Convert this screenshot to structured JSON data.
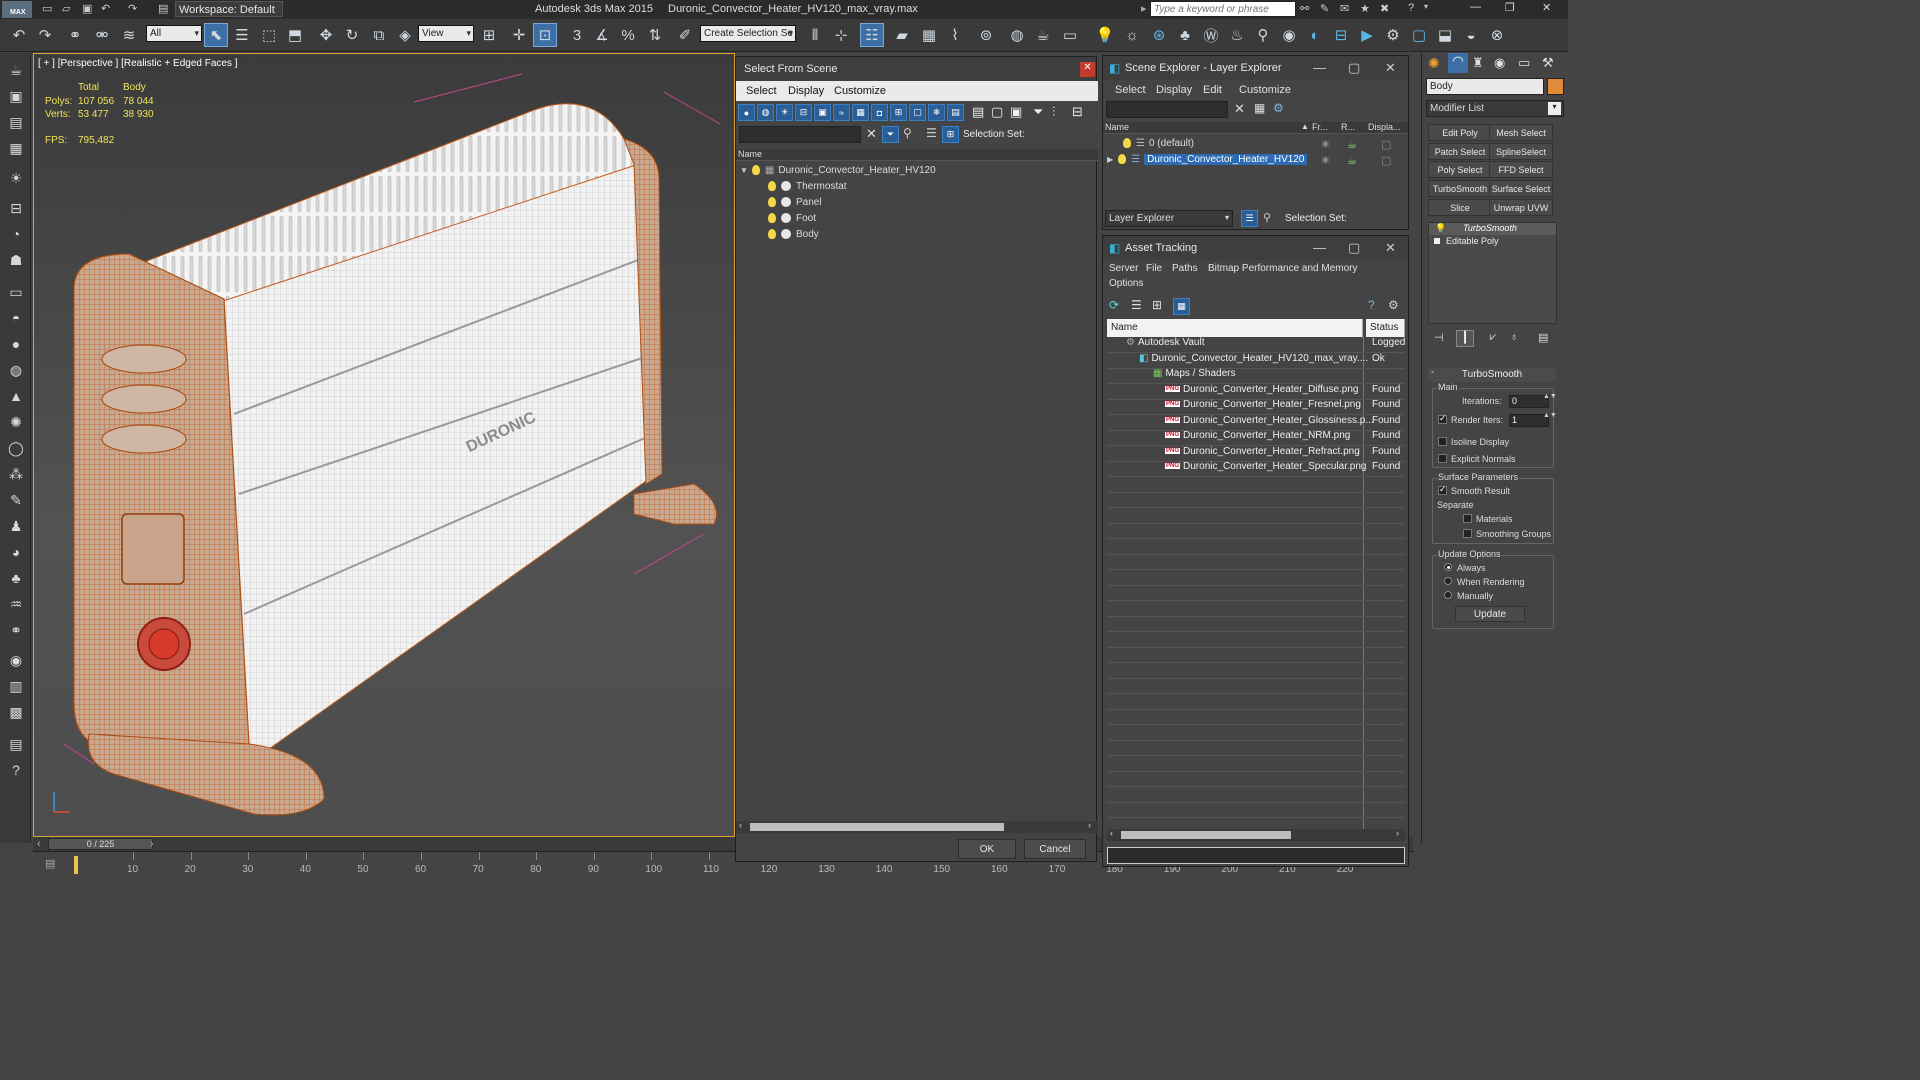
{
  "app": {
    "title": "Autodesk 3ds Max  2015",
    "file": "Duronic_Convector_Heater_HV120_max_vray.max",
    "logo": "MAX",
    "workspace": "Workspace: Default",
    "search_placeholder": "Type a keyword or phrase"
  },
  "toolbar": {
    "filter": "All",
    "ref_coord": "View",
    "selection_set_placeholder": "Create Selection Se"
  },
  "viewport": {
    "label": "[ + ] [Perspective ] [Realistic + Edged Faces ]",
    "stats_header_total": "Total",
    "stats_header_obj": "Body",
    "polys_label": "Polys:",
    "polys_total": "107 056",
    "polys_obj": "78 044",
    "verts_label": "Verts:",
    "verts_total": "53 477",
    "verts_obj": "38 930",
    "fps_label": "FPS:",
    "fps_value": "795,482",
    "brand_text": "DURONIC"
  },
  "timeline": {
    "frame": "0 / 225",
    "ticks": [
      "10",
      "20",
      "30",
      "40",
      "50",
      "60",
      "70",
      "80",
      "90",
      "100",
      "110",
      "120",
      "130",
      "140",
      "150",
      "160",
      "170",
      "180",
      "190",
      "200",
      "210",
      "220"
    ]
  },
  "select_from_scene": {
    "title": "Select From Scene",
    "menus": [
      "Select",
      "Display",
      "Customize"
    ],
    "selection_set_label": "Selection Set:",
    "column_name": "Name",
    "root": "Duronic_Convector_Heater_HV120",
    "children": [
      "Thermostat",
      "Panel",
      "Foot",
      "Body"
    ],
    "ok": "OK",
    "cancel": "Cancel"
  },
  "scene_explorer": {
    "title": "Scene Explorer - Layer Explorer",
    "menus": [
      "Select",
      "Display",
      "Edit",
      "Customize"
    ],
    "columns": [
      "Name",
      "Fr...",
      "R...",
      "Displa..."
    ],
    "rows": [
      "0 (default)",
      "Duronic_Convector_Heater_HV120"
    ],
    "footer_combo": "Layer Explorer",
    "footer_label": "Selection Set:"
  },
  "asset_tracking": {
    "title": "Asset Tracking",
    "menus": [
      "Server",
      "File",
      "Paths",
      "Bitmap Performance and Memory",
      "Options"
    ],
    "columns": [
      "Name",
      "Status"
    ],
    "rows": [
      {
        "name": "Autodesk Vault",
        "status": "Logged"
      },
      {
        "name": "Duronic_Convector_Heater_HV120_max_vray....",
        "status": "Ok"
      },
      {
        "name": "Maps / Shaders",
        "status": ""
      },
      {
        "name": "Duronic_Converter_Heater_Diffuse.png",
        "status": "Found"
      },
      {
        "name": "Duronic_Converter_Heater_Fresnel.png",
        "status": "Found"
      },
      {
        "name": "Duronic_Converter_Heater_Glossiness.p...",
        "status": "Found"
      },
      {
        "name": "Duronic_Converter_Heater_NRM.png",
        "status": "Found"
      },
      {
        "name": "Duronic_Converter_Heater_Refract.png",
        "status": "Found"
      },
      {
        "name": "Duronic_Converter_Heater_Specular.png",
        "status": "Found"
      }
    ],
    "png_badge": "PNG"
  },
  "command_panel": {
    "object_name": "Body",
    "modifier_list": "Modifier List",
    "modifier_buttons": [
      "Edit Poly",
      "Mesh Select",
      "Patch Select",
      "SplineSelect",
      "Poly Select",
      "FFD Select",
      "TurboSmooth",
      "Surface Select",
      "Slice",
      "Unwrap UVW"
    ],
    "stack": [
      "TurboSmooth",
      "Editable Poly"
    ],
    "rollout_title": "TurboSmooth",
    "main_label": "Main",
    "iterations_label": "Iterations:",
    "iterations_value": "0",
    "render_iters_label": "Render Iters:",
    "render_iters_value": "1",
    "isoline_display": "Isoline Display",
    "explicit_normals": "Explicit Normals",
    "surface_params": "Surface Parameters",
    "smooth_result": "Smooth Result",
    "separate": "Separate",
    "materials": "Materials",
    "smoothing_groups": "Smoothing Groups",
    "update_options": "Update Options",
    "always": "Always",
    "when_rendering": "When Rendering",
    "manually": "Manually",
    "update": "Update"
  }
}
